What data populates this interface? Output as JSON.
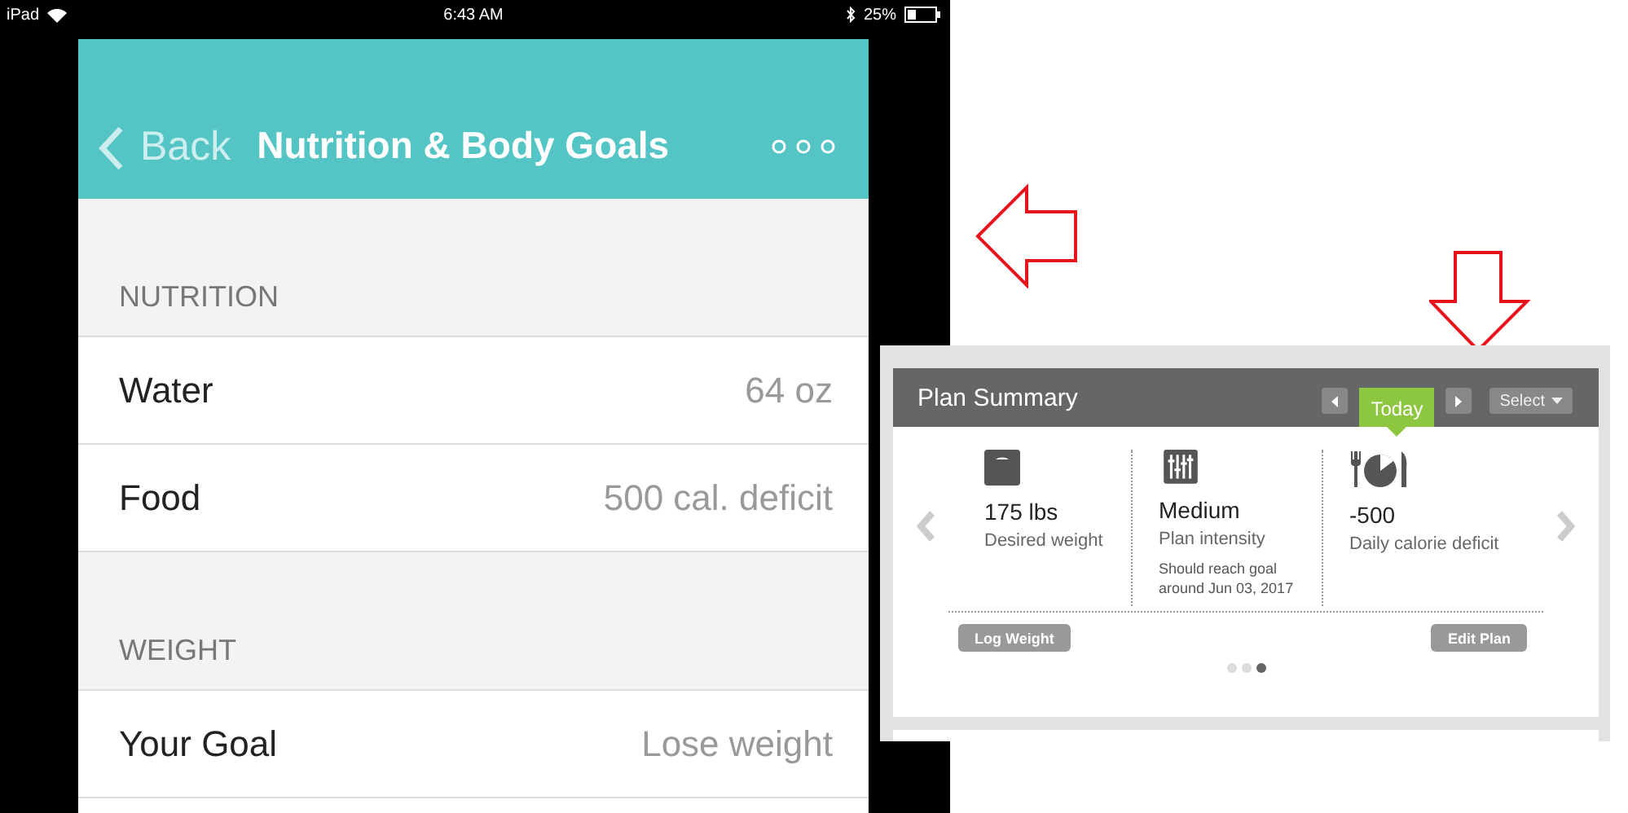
{
  "status_bar": {
    "device": "iPad",
    "time": "6:43 AM",
    "battery": "25%"
  },
  "nav": {
    "back": "Back",
    "title": "Nutrition & Body Goals"
  },
  "sections": [
    {
      "header": "NUTRITION",
      "rows": [
        {
          "label": "Water",
          "value": "64 oz"
        },
        {
          "label": "Food",
          "value": "500 cal. deficit"
        }
      ]
    },
    {
      "header": "WEIGHT",
      "rows": [
        {
          "label": "Your Goal",
          "value": "Lose weight"
        }
      ]
    }
  ],
  "plan_summary": {
    "title": "Plan Summary",
    "today": "Today",
    "select": "Select",
    "items": [
      {
        "kind": "scale",
        "value": "175 lbs",
        "label": "Desired weight"
      },
      {
        "kind": "sliders",
        "value": "Medium",
        "label": "Plan intensity",
        "note": "Should reach goal around Jun 03, 2017"
      },
      {
        "kind": "meal",
        "value": "-500",
        "label": "Daily calorie deficit"
      }
    ],
    "buttons": [
      "Log Weight",
      "Edit Plan"
    ],
    "pages": [
      {
        "selected": false
      },
      {
        "selected": false
      },
      {
        "selected": true
      }
    ]
  }
}
